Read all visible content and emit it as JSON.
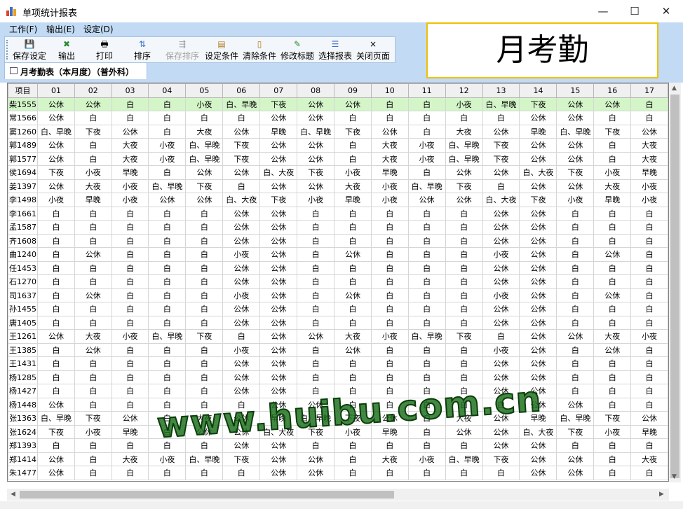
{
  "window": {
    "title": "单项统计报表",
    "minimize": "—",
    "maximize": "☐",
    "close": "✕"
  },
  "menu": [
    "工作(F)",
    "输出(E)",
    "设定(D)"
  ],
  "toolbar": [
    {
      "label": "保存设定",
      "icon": "save-icon",
      "glyph": "💾",
      "enabled": true
    },
    {
      "label": "输出",
      "icon": "export-icon",
      "glyph": "✖",
      "enabled": true
    },
    {
      "label": "打印",
      "icon": "printer-icon",
      "glyph": "🖶",
      "enabled": true
    },
    {
      "label": "排序",
      "icon": "sort-icon",
      "glyph": "⇅",
      "enabled": true
    },
    {
      "label": "保存排序",
      "icon": "save-sort-icon",
      "glyph": "⇶",
      "enabled": false
    },
    {
      "label": "设定条件",
      "icon": "set-condition-icon",
      "glyph": "▤",
      "enabled": true
    },
    {
      "label": "清除条件",
      "icon": "clear-condition-icon",
      "glyph": "▯",
      "enabled": true
    },
    {
      "label": "修改标题",
      "icon": "edit-title-icon",
      "glyph": "✎",
      "enabled": true
    },
    {
      "label": "选择报表",
      "icon": "select-report-icon",
      "glyph": "☰",
      "enabled": true
    },
    {
      "label": "关闭页面",
      "icon": "close-page-icon",
      "glyph": "×",
      "enabled": true
    }
  ],
  "banner": "月考勤",
  "tab": {
    "label": "月考勤表（本月度）（普外科）",
    "icon": "table-icon"
  },
  "grid": {
    "headers": [
      "项目",
      "01",
      "02",
      "03",
      "04",
      "05",
      "06",
      "07",
      "08",
      "09",
      "10",
      "11",
      "12",
      "13",
      "14",
      "15",
      "16",
      "17"
    ],
    "selected_row": 0,
    "rows": [
      [
        "柴1555",
        "公休",
        "公休",
        "白",
        "白",
        "小夜",
        "白、早晚",
        "下夜",
        "公休",
        "公休",
        "白",
        "白",
        "小夜",
        "白、早晚",
        "下夜",
        "公休",
        "公休",
        "白"
      ],
      [
        "常1566",
        "公休",
        "白",
        "白",
        "白",
        "白",
        "白",
        "公休",
        "公休",
        "白",
        "白",
        "白",
        "白",
        "白",
        "公休",
        "公休",
        "白",
        "白"
      ],
      [
        "窦1260",
        "白、早晚",
        "下夜",
        "公休",
        "白",
        "大夜",
        "公休",
        "早晚",
        "白、早晚",
        "下夜",
        "公休",
        "白",
        "大夜",
        "公休",
        "早晚",
        "白、早晚",
        "下夜",
        "公休"
      ],
      [
        "郭1489",
        "公休",
        "白",
        "大夜",
        "小夜",
        "白、早晚",
        "下夜",
        "公休",
        "公休",
        "白",
        "大夜",
        "小夜",
        "白、早晚",
        "下夜",
        "公休",
        "公休",
        "白",
        "大夜"
      ],
      [
        "郭1577",
        "公休",
        "白",
        "大夜",
        "小夜",
        "白、早晚",
        "下夜",
        "公休",
        "公休",
        "白",
        "大夜",
        "小夜",
        "白、早晚",
        "下夜",
        "公休",
        "公休",
        "白",
        "大夜"
      ],
      [
        "侯1694",
        "下夜",
        "小夜",
        "早晚",
        "白",
        "公休",
        "公休",
        "白、大夜",
        "下夜",
        "小夜",
        "早晚",
        "白",
        "公休",
        "公休",
        "白、大夜",
        "下夜",
        "小夜",
        "早晚"
      ],
      [
        "姜1397",
        "公休",
        "大夜",
        "小夜",
        "白、早晚",
        "下夜",
        "白",
        "公休",
        "公休",
        "大夜",
        "小夜",
        "白、早晚",
        "下夜",
        "白",
        "公休",
        "公休",
        "大夜",
        "小夜"
      ],
      [
        "李1498",
        "小夜",
        "早晚",
        "小夜",
        "公休",
        "公休",
        "白、大夜",
        "下夜",
        "小夜",
        "早晚",
        "小夜",
        "公休",
        "公休",
        "白、大夜",
        "下夜",
        "小夜",
        "早晚",
        "小夜"
      ],
      [
        "李1661",
        "白",
        "白",
        "白",
        "白",
        "白",
        "公休",
        "公休",
        "白",
        "白",
        "白",
        "白",
        "白",
        "公休",
        "公休",
        "白",
        "白",
        "白"
      ],
      [
        "孟1587",
        "白",
        "白",
        "白",
        "白",
        "白",
        "公休",
        "公休",
        "白",
        "白",
        "白",
        "白",
        "白",
        "公休",
        "公休",
        "白",
        "白",
        "白"
      ],
      [
        "齐1608",
        "白",
        "白",
        "白",
        "白",
        "白",
        "公休",
        "公休",
        "白",
        "白",
        "白",
        "白",
        "白",
        "公休",
        "公休",
        "白",
        "白",
        "白"
      ],
      [
        "曲1240",
        "白",
        "公休",
        "白",
        "白",
        "白",
        "小夜",
        "公休",
        "白",
        "公休",
        "白",
        "白",
        "白",
        "小夜",
        "公休",
        "白",
        "公休",
        "白"
      ],
      [
        "任1453",
        "白",
        "白",
        "白",
        "白",
        "白",
        "公休",
        "公休",
        "白",
        "白",
        "白",
        "白",
        "白",
        "公休",
        "公休",
        "白",
        "白",
        "白"
      ],
      [
        "石1270",
        "白",
        "白",
        "白",
        "白",
        "白",
        "公休",
        "公休",
        "白",
        "白",
        "白",
        "白",
        "白",
        "公休",
        "公休",
        "白",
        "白",
        "白"
      ],
      [
        "司1637",
        "白",
        "公休",
        "白",
        "白",
        "白",
        "小夜",
        "公休",
        "白",
        "公休",
        "白",
        "白",
        "白",
        "小夜",
        "公休",
        "白",
        "公休",
        "白"
      ],
      [
        "孙1455",
        "白",
        "白",
        "白",
        "白",
        "白",
        "公休",
        "公休",
        "白",
        "白",
        "白",
        "白",
        "白",
        "公休",
        "公休",
        "白",
        "白",
        "白"
      ],
      [
        "唐1405",
        "白",
        "白",
        "白",
        "白",
        "白",
        "公休",
        "公休",
        "白",
        "白",
        "白",
        "白",
        "白",
        "公休",
        "公休",
        "白",
        "白",
        "白"
      ],
      [
        "王1261",
        "公休",
        "大夜",
        "小夜",
        "白、早晚",
        "下夜",
        "白",
        "公休",
        "公休",
        "大夜",
        "小夜",
        "白、早晚",
        "下夜",
        "白",
        "公休",
        "公休",
        "大夜",
        "小夜"
      ],
      [
        "王1385",
        "白",
        "公休",
        "白",
        "白",
        "白",
        "小夜",
        "公休",
        "白",
        "公休",
        "白",
        "白",
        "白",
        "小夜",
        "公休",
        "白",
        "公休",
        "白"
      ],
      [
        "王1431",
        "白",
        "白",
        "白",
        "白",
        "白",
        "公休",
        "公休",
        "白",
        "白",
        "白",
        "白",
        "白",
        "公休",
        "公休",
        "白",
        "白",
        "白"
      ],
      [
        "杨1285",
        "白",
        "白",
        "白",
        "白",
        "白",
        "公休",
        "公休",
        "白",
        "白",
        "白",
        "白",
        "白",
        "公休",
        "公休",
        "白",
        "白",
        "白"
      ],
      [
        "杨1427",
        "白",
        "白",
        "白",
        "白",
        "白",
        "公休",
        "公休",
        "白",
        "白",
        "白",
        "白",
        "白",
        "公休",
        "公休",
        "白",
        "白",
        "白"
      ],
      [
        "杨1448",
        "公休",
        "白",
        "白",
        "白",
        "白",
        "白",
        "公休",
        "公休",
        "白",
        "白",
        "白",
        "白",
        "白",
        "公休",
        "公休",
        "白",
        "白"
      ],
      [
        "张1363",
        "白、早晚",
        "下夜",
        "公休",
        "白",
        "大夜",
        "公休",
        "早晚",
        "白、早晚",
        "下夜",
        "公休",
        "白",
        "大夜",
        "公休",
        "早晚",
        "白、早晚",
        "下夜",
        "公休"
      ],
      [
        "张1624",
        "下夜",
        "小夜",
        "早晚",
        "白",
        "公休",
        "公休",
        "白、大夜",
        "下夜",
        "小夜",
        "早晚",
        "白",
        "公休",
        "公休",
        "白、大夜",
        "下夜",
        "小夜",
        "早晚"
      ],
      [
        "郑1393",
        "白",
        "白",
        "白",
        "白",
        "白",
        "公休",
        "公休",
        "白",
        "白",
        "白",
        "白",
        "白",
        "公休",
        "公休",
        "白",
        "白",
        "白"
      ],
      [
        "郑1414",
        "公休",
        "白",
        "大夜",
        "小夜",
        "白、早晚",
        "下夜",
        "公休",
        "公休",
        "白",
        "大夜",
        "小夜",
        "白、早晚",
        "下夜",
        "公休",
        "公休",
        "白",
        "大夜"
      ],
      [
        "朱1477",
        "公休",
        "白",
        "白",
        "白",
        "白",
        "白",
        "公休",
        "公休",
        "白",
        "白",
        "白",
        "白",
        "白",
        "公休",
        "公休",
        "白",
        "白"
      ]
    ]
  },
  "watermark": "www.huibu.com.cn",
  "colors": {
    "chrome": "#c2daf3",
    "selected_row": "#d3f5c8",
    "banner_border": "#f0c000",
    "watermark": "#186e18"
  }
}
